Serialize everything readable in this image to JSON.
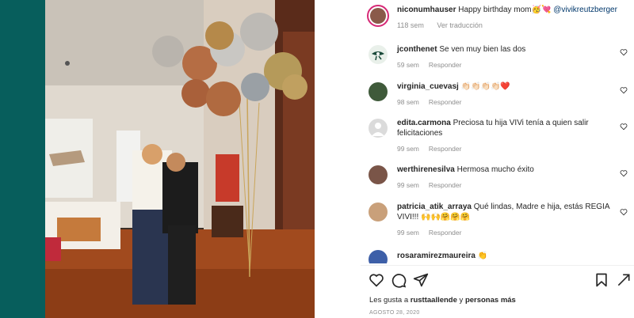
{
  "post": {
    "author": "niconumhauser",
    "caption_text": "Happy birthday mom🥳💘",
    "mention": "@vivikreutzberger",
    "time_ago": "118 sem",
    "translate_label": "Ver traducción"
  },
  "comments": [
    {
      "user": "jconthenet",
      "text": "Se ven muy bien las dos",
      "time": "59 sem",
      "reply": "Responder"
    },
    {
      "user": "virginia_cuevasj",
      "text": "👏🏻👏🏻👏🏻👏🏻❤️",
      "time": "98 sem",
      "reply": "Responder"
    },
    {
      "user": "edita.carmona",
      "text": "Preciosa tu hija VIVi tenía a quien salir felicitaciones",
      "time": "99 sem",
      "reply": "Responder"
    },
    {
      "user": "werthirenesilva",
      "text": "Hermosa mucho éxito",
      "time": "99 sem",
      "reply": "Responder"
    },
    {
      "user": "patricia_atik_arraya",
      "text": "Qué lindas, Madre e hija, estás REGIA VIVI!!! 🙌🙌🤗🤗🤗",
      "time": "99 sem",
      "reply": "Responder"
    },
    {
      "user": "rosaramirezmaureira",
      "text": "👏",
      "time": "",
      "reply": ""
    }
  ],
  "footer": {
    "likes_prefix": "Les gusta a",
    "likes_user": "rusttaallende",
    "likes_middle": "y",
    "likes_others": "personas más",
    "date": "AGOSTO 28, 2020"
  },
  "colors": {
    "link": "#00376b",
    "muted": "#8e8e8e",
    "text": "#262626",
    "story_ring": "#d62976"
  },
  "icons": [
    "heart-icon",
    "comment-icon",
    "share-icon",
    "bookmark-icon",
    "more-icon"
  ]
}
